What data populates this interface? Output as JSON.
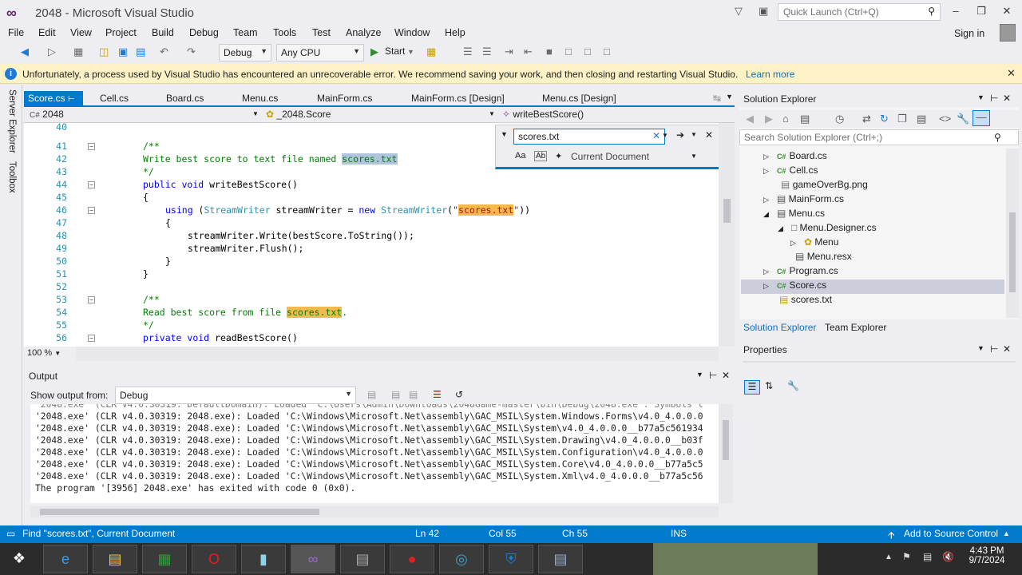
{
  "window": {
    "title": "2048 - Microsoft Visual Studio"
  },
  "quick_launch": {
    "placeholder": "Quick Launch (Ctrl+Q)"
  },
  "menu": [
    "File",
    "Edit",
    "View",
    "Project",
    "Build",
    "Debug",
    "Team",
    "Tools",
    "Test",
    "Analyze",
    "Window",
    "Help"
  ],
  "sign_in": "Sign in",
  "toolbar": {
    "config": "Debug",
    "platform": "Any CPU",
    "start": "Start"
  },
  "infobar": {
    "message": "Unfortunately, a process used by Visual Studio has encountered an unrecoverable error.  We recommend saving your work, and then closing and restarting Visual Studio.",
    "link": "Learn more"
  },
  "rail": {
    "server_explorer": "Server Explorer",
    "toolbox": "Toolbox"
  },
  "tabs": [
    "Score.cs",
    "Cell.cs",
    "Board.cs",
    "Menu.cs",
    "MainForm.cs",
    "MainForm.cs [Design]",
    "Menu.cs [Design]"
  ],
  "navbar": {
    "project": "2048",
    "type": "_2048.Score",
    "member": "writeBestScore()"
  },
  "find": {
    "query": "scores.txt",
    "scope": "Current Document",
    "match_case": "Aa",
    "whole_word": "Ab"
  },
  "code_lines": [
    {
      "n": "40",
      "t": ""
    },
    {
      "n": "41",
      "t": "/**"
    },
    {
      "n": "42",
      "t": "Write best score to text file named scores.txt"
    },
    {
      "n": "43",
      "t": "*/"
    },
    {
      "n": "44",
      "t": "public void writeBestScore()"
    },
    {
      "n": "45",
      "t": "{"
    },
    {
      "n": "46",
      "t": "using (StreamWriter streamWriter = new StreamWriter(\"scores.txt\"))"
    },
    {
      "n": "47",
      "t": "{"
    },
    {
      "n": "48",
      "t": "streamWriter.Write(bestScore.ToString());"
    },
    {
      "n": "49",
      "t": "streamWriter.Flush();"
    },
    {
      "n": "50",
      "t": "}"
    },
    {
      "n": "51",
      "t": "}"
    },
    {
      "n": "52",
      "t": ""
    },
    {
      "n": "53",
      "t": "/**"
    },
    {
      "n": "54",
      "t": "Read best score from file scores.txt."
    },
    {
      "n": "55",
      "t": "*/"
    },
    {
      "n": "56",
      "t": "private void readBestScore()"
    }
  ],
  "zoom": "100 %",
  "output": {
    "title": "Output",
    "show_from_label": "Show output from:",
    "source": "Debug",
    "lines": [
      "'2048.exe' (CLR v4.0.30319: 2048.exe): Loaded 'C:\\Windows\\Microsoft.Net\\assembly\\GAC_MSIL\\System.Windows.Forms\\v4.0_4.0.0.0",
      "'2048.exe' (CLR v4.0.30319: 2048.exe): Loaded 'C:\\Windows\\Microsoft.Net\\assembly\\GAC_MSIL\\System\\v4.0_4.0.0.0__b77a5c561934",
      "'2048.exe' (CLR v4.0.30319: 2048.exe): Loaded 'C:\\Windows\\Microsoft.Net\\assembly\\GAC_MSIL\\System.Drawing\\v4.0_4.0.0.0__b03f",
      "'2048.exe' (CLR v4.0.30319: 2048.exe): Loaded 'C:\\Windows\\Microsoft.Net\\assembly\\GAC_MSIL\\System.Configuration\\v4.0_4.0.0.0",
      "'2048.exe' (CLR v4.0.30319: 2048.exe): Loaded 'C:\\Windows\\Microsoft.Net\\assembly\\GAC_MSIL\\System.Core\\v4.0_4.0.0.0__b77a5c5",
      "'2048.exe' (CLR v4.0.30319: 2048.exe): Loaded 'C:\\Windows\\Microsoft.Net\\assembly\\GAC_MSIL\\System.Xml\\v4.0_4.0.0.0__b77a5c56",
      "The program '[3956] 2048.exe' has exited with code 0 (0x0)."
    ]
  },
  "solution_explorer": {
    "title": "Solution Explorer",
    "search_placeholder": "Search Solution Explorer (Ctrl+;)",
    "items": [
      "Board.cs",
      "Cell.cs",
      "gameOverBg.png",
      "MainForm.cs",
      "Menu.cs",
      "Menu.Designer.cs",
      "Menu",
      "Menu.resx",
      "Program.cs",
      "Score.cs",
      "scores.txt"
    ],
    "tabs": [
      "Solution Explorer",
      "Team Explorer"
    ]
  },
  "properties": {
    "title": "Properties"
  },
  "status": {
    "message": "Find \"scores.txt\", Current Document",
    "ln": "Ln 42",
    "col": "Col 55",
    "ch": "Ch 55",
    "mode": "INS",
    "source_control": "Add to Source Control"
  },
  "clock": {
    "time": "4:43 PM",
    "date": "9/7/2024"
  }
}
